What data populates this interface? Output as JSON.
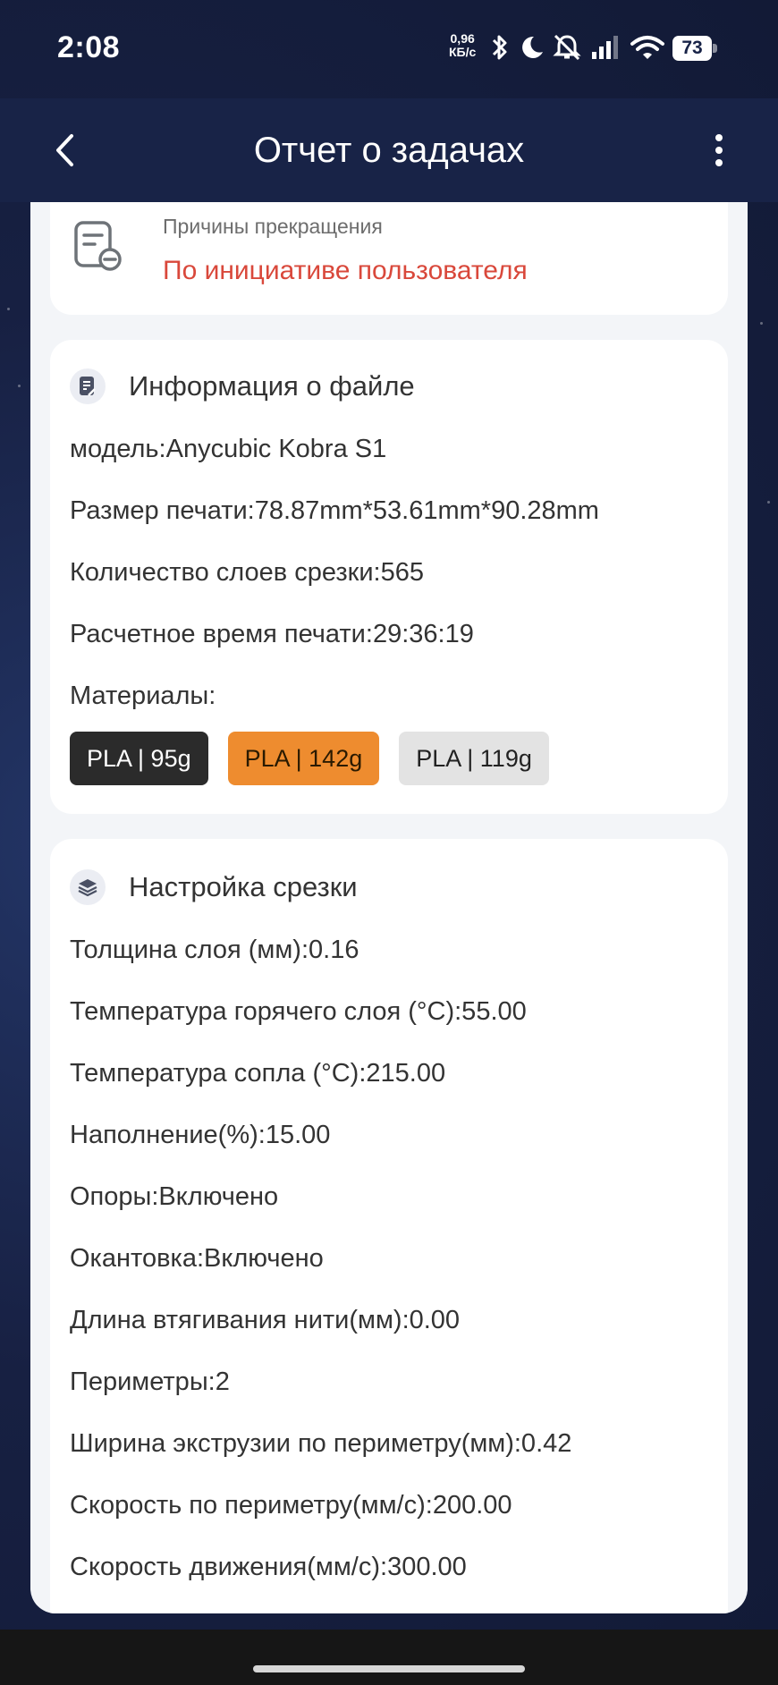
{
  "status_bar": {
    "time": "2:08",
    "net_speed_value": "0,96",
    "net_speed_unit": "КБ/с",
    "battery": "73"
  },
  "header": {
    "title": "Отчет о задачах"
  },
  "termination": {
    "label": "Причины прекращения",
    "value": "По инициативе пользователя"
  },
  "file_info": {
    "title": "Информация о файле",
    "lines": [
      "модель:Anycubic Kobra S1",
      "Размер печати:78.87mm*53.61mm*90.28mm",
      "Количество слоев срезки:565",
      "Расчетное время печати:29:36:19"
    ],
    "materials_label": "Материалы:",
    "materials": [
      {
        "label": "PLA | 95g",
        "color": "#2b2b2b",
        "text_color": "#ffffff"
      },
      {
        "label": "PLA | 142g",
        "color": "#ee8c2f",
        "text_color": "#2a1a00"
      },
      {
        "label": "PLA | 119g",
        "color": "#e3e3e3",
        "text_color": "#222222"
      }
    ]
  },
  "slice_settings": {
    "title": "Настройка срезки",
    "lines": [
      "Толщина слоя (мм):0.16",
      "Температура горячего слоя (°C):55.00",
      "Температура сопла (°C):215.00",
      "Наполнение(%):15.00",
      "Опоры:Включено",
      "Окантовка:Включено",
      "Длина втягивания нити(мм):0.00",
      "Периметры:2",
      "Ширина экструзии по периметру(мм):0.42",
      "Скорость по периметру(мм/с):200.00",
      "Скорость движения(мм/с):300.00"
    ]
  }
}
